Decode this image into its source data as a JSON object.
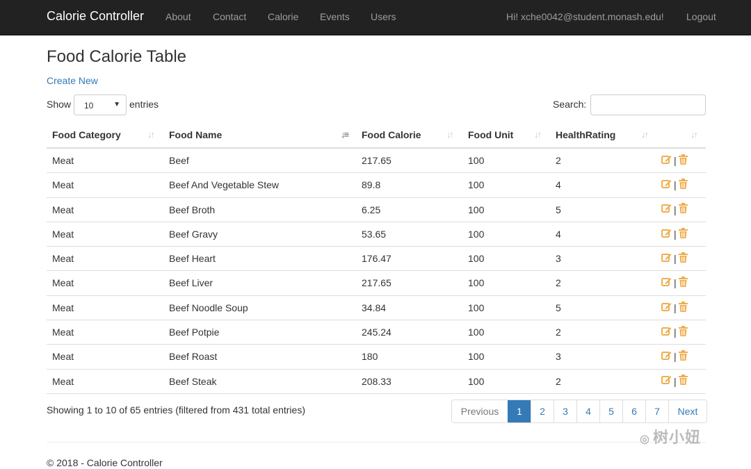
{
  "navbar": {
    "brand": "Calorie Controller",
    "links": [
      "About",
      "Contact",
      "Calorie",
      "Events",
      "Users"
    ],
    "greeting": "Hi! xche0042@student.monash.edu!",
    "logout": "Logout"
  },
  "page": {
    "title": "Food Calorie Table",
    "create_new": "Create New"
  },
  "length": {
    "show_label": "Show",
    "value": "10",
    "entries_label": "entries"
  },
  "search": {
    "label": "Search:",
    "value": ""
  },
  "table": {
    "headers": [
      "Food Category",
      "Food Name",
      "Food Calorie",
      "Food Unit",
      "HealthRating",
      ""
    ],
    "sorted_column": "Food Name",
    "rows": [
      [
        "Meat",
        "Beef",
        "217.65",
        "100",
        "2"
      ],
      [
        "Meat",
        "Beef And Vegetable Stew",
        "89.8",
        "100",
        "4"
      ],
      [
        "Meat",
        "Beef Broth",
        "6.25",
        "100",
        "5"
      ],
      [
        "Meat",
        "Beef Gravy",
        "53.65",
        "100",
        "4"
      ],
      [
        "Meat",
        "Beef Heart",
        "176.47",
        "100",
        "3"
      ],
      [
        "Meat",
        "Beef Liver",
        "217.65",
        "100",
        "2"
      ],
      [
        "Meat",
        "Beef Noodle Soup",
        "34.84",
        "100",
        "5"
      ],
      [
        "Meat",
        "Beef Potpie",
        "245.24",
        "100",
        "2"
      ],
      [
        "Meat",
        "Beef Roast",
        "180",
        "100",
        "3"
      ],
      [
        "Meat",
        "Beef Steak",
        "208.33",
        "100",
        "2"
      ]
    ],
    "row_action_icons": [
      "edit-icon",
      "trash-icon"
    ],
    "action_separator": "|",
    "action_color": "#f0ad4e"
  },
  "info": "Showing 1 to 10 of 65 entries (filtered from 431 total entries)",
  "pagination": {
    "previous": "Previous",
    "pages": [
      "1",
      "2",
      "3",
      "4",
      "5",
      "6",
      "7"
    ],
    "current": "1",
    "next": "Next"
  },
  "footer": {
    "copyright": "© 2018 - Calorie Controller"
  },
  "watermark": "树小妞",
  "colors": {
    "navbar_bg": "#222222",
    "link": "#337ab7",
    "active_page": "#337ab7"
  }
}
